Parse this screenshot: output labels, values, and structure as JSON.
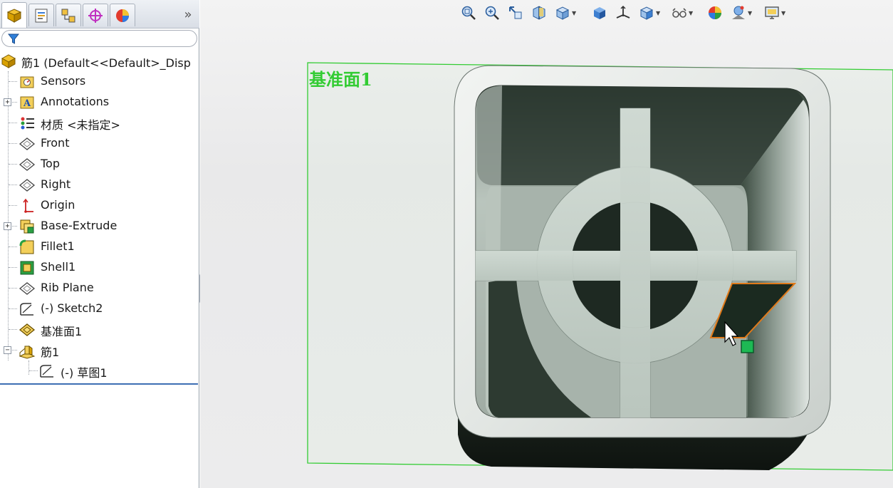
{
  "panel": {
    "tabs": [
      {
        "name": "featuremanager-tab",
        "icon": "featuremanager-icon"
      },
      {
        "name": "propertymanager-tab",
        "icon": "propertymanager-icon"
      },
      {
        "name": "configurationmanager-tab",
        "icon": "configurationmanager-icon"
      },
      {
        "name": "dimxpertmanager-tab",
        "icon": "dimxpert-icon"
      },
      {
        "name": "display-manager-tab",
        "icon": "appearance-icon"
      }
    ],
    "more_tabs": "»"
  },
  "tree": {
    "root_label": "筋1  (Default<<Default>_Disp",
    "items": [
      {
        "label": "Sensors",
        "icon": "sensors-icon"
      },
      {
        "label": "Annotations",
        "icon": "annotations-icon"
      },
      {
        "label": "材质 <未指定>",
        "icon": "material-icon"
      },
      {
        "label": "Front",
        "icon": "plane-icon"
      },
      {
        "label": "Top",
        "icon": "plane-icon"
      },
      {
        "label": "Right",
        "icon": "plane-icon"
      },
      {
        "label": "Origin",
        "icon": "origin-icon"
      },
      {
        "label": "Base-Extrude",
        "icon": "extrude-icon"
      },
      {
        "label": "Fillet1",
        "icon": "fillet-icon"
      },
      {
        "label": "Shell1",
        "icon": "shell-icon"
      },
      {
        "label": "Rib Plane",
        "icon": "plane-icon"
      },
      {
        "label": "(-) Sketch2",
        "icon": "sketch-icon"
      },
      {
        "label": "基准面1",
        "icon": "plane-selected-icon"
      },
      {
        "label": "筋1",
        "icon": "rib-icon"
      },
      {
        "label": "(-) 草图1",
        "icon": "sketch-icon"
      }
    ]
  },
  "viewport": {
    "plane_label": "基准面1",
    "hud_icons": [
      "zoom-to-fit-icon",
      "zoom-to-area-icon",
      "previous-view-icon",
      "section-view-icon",
      "view-orientation-icon",
      "display-style-icon",
      "hide-show-items-icon",
      "edit-appearance-icon",
      "apply-scene-icon",
      "view-settings-icon",
      "appearance-sphere-icon",
      "scene-icon",
      "screen-capture-icon"
    ]
  },
  "colors": {
    "plane_green": "#33cc33",
    "model_light": "#c9d3cc",
    "model_dark": "#1f2a22",
    "selection_orange": "#e07a1a",
    "handle_green": "#1db954"
  }
}
